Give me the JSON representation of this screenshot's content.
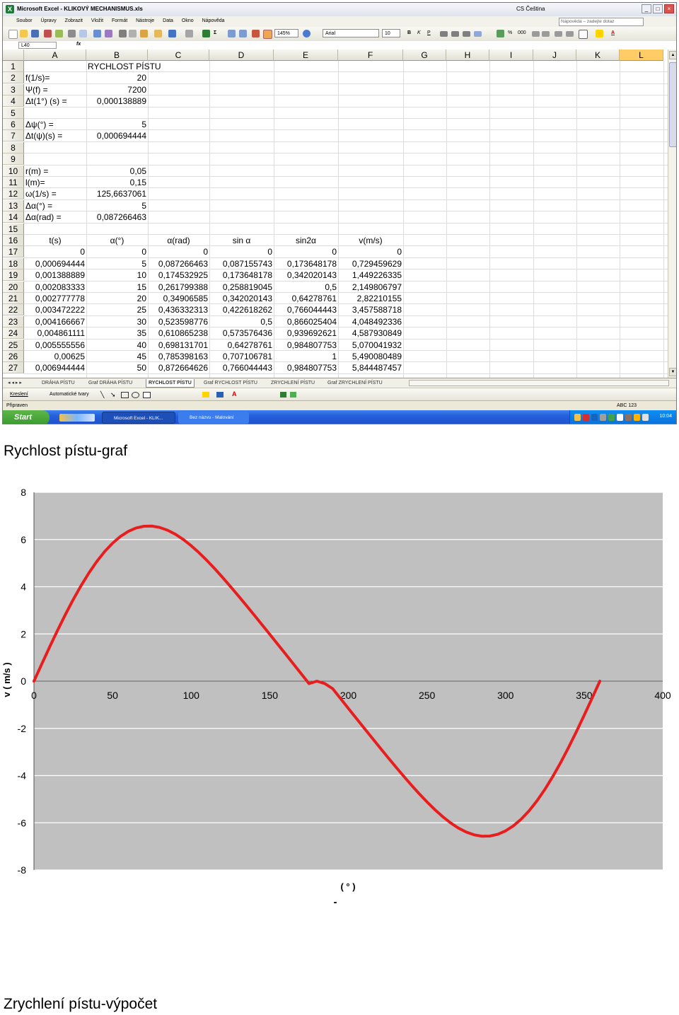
{
  "window": {
    "title": "Microsoft Excel - KLIKOVÝ MECHANISMUS.xls",
    "language": "CS Čeština",
    "buttons": [
      "_",
      "□",
      "×"
    ]
  },
  "menu": {
    "items": [
      "Soubor",
      "Úpravy",
      "Zobrazit",
      "Vložit",
      "Formát",
      "Nástroje",
      "Data",
      "Okno",
      "Nápověda"
    ],
    "help_placeholder": "Nápověda – zadejte dotaz"
  },
  "toolbar": {
    "zoom": "145%",
    "font": "Arial",
    "font_size": "10",
    "bold": "B",
    "italic": "K",
    "underline": "P"
  },
  "formula_bar": {
    "name_box": "L40",
    "fx": "fx",
    "content": ""
  },
  "sheet": {
    "columns": [
      "A",
      "B",
      "C",
      "D",
      "E",
      "F",
      "G",
      "H",
      "I",
      "J",
      "K",
      "L"
    ],
    "selected_column": "L",
    "rows": [
      {
        "n": "1",
        "A": "",
        "B": "RYCHLOST PÍSTU",
        "C": "",
        "D": "",
        "E": "",
        "F": ""
      },
      {
        "n": "2",
        "A": "f(1/s)=",
        "B": "20",
        "C": "",
        "D": "",
        "E": "",
        "F": ""
      },
      {
        "n": "3",
        "A": "Ψ(f) =",
        "B": "7200",
        "C": "",
        "D": "",
        "E": "",
        "F": ""
      },
      {
        "n": "4",
        "A": "Δt(1°) (s) =",
        "B": "0,000138889",
        "C": "",
        "D": "",
        "E": "",
        "F": ""
      },
      {
        "n": "5",
        "A": "",
        "B": "",
        "C": "",
        "D": "",
        "E": "",
        "F": ""
      },
      {
        "n": "6",
        "A": "Δψ(°) =",
        "B": "5",
        "C": "",
        "D": "",
        "E": "",
        "F": ""
      },
      {
        "n": "7",
        "A": "Δt(ψ)(s) =",
        "B": "0,000694444",
        "C": "",
        "D": "",
        "E": "",
        "F": ""
      },
      {
        "n": "8",
        "A": "",
        "B": "",
        "C": "",
        "D": "",
        "E": "",
        "F": ""
      },
      {
        "n": "9",
        "A": "",
        "B": "",
        "C": "",
        "D": "",
        "E": "",
        "F": ""
      },
      {
        "n": "10",
        "A": "r(m) =",
        "B": "0,05",
        "C": "",
        "D": "",
        "E": "",
        "F": ""
      },
      {
        "n": "11",
        "A": "l(m)=",
        "B": "0,15",
        "C": "",
        "D": "",
        "E": "",
        "F": ""
      },
      {
        "n": "12",
        "A": "ω(1/s) =",
        "B": "125,6637061",
        "C": "",
        "D": "",
        "E": "",
        "F": ""
      },
      {
        "n": "13",
        "A": "Δα(°) =",
        "B": "5",
        "C": "",
        "D": "",
        "E": "",
        "F": ""
      },
      {
        "n": "14",
        "A": "Δα(rad) =",
        "B": "0,087266463",
        "C": "",
        "D": "",
        "E": "",
        "F": ""
      },
      {
        "n": "15",
        "A": "",
        "B": "",
        "C": "",
        "D": "",
        "E": "",
        "F": ""
      },
      {
        "n": "16",
        "A": "t(s)",
        "B": "α(°)",
        "C": "α(rad)",
        "D": "sin α",
        "E": "sin2α",
        "F": "v(m/s)"
      },
      {
        "n": "17",
        "A": "0",
        "B": "0",
        "C": "0",
        "D": "0",
        "E": "0",
        "F": "0"
      },
      {
        "n": "18",
        "A": "0,000694444",
        "B": "5",
        "C": "0,087266463",
        "D": "0,087155743",
        "E": "0,173648178",
        "F": "0,729459629"
      },
      {
        "n": "19",
        "A": "0,001388889",
        "B": "10",
        "C": "0,174532925",
        "D": "0,173648178",
        "E": "0,342020143",
        "F": "1,449226335"
      },
      {
        "n": "20",
        "A": "0,002083333",
        "B": "15",
        "C": "0,261799388",
        "D": "0,258819045",
        "E": "0,5",
        "F": "2,149806797"
      },
      {
        "n": "21",
        "A": "0,002777778",
        "B": "20",
        "C": "0,34906585",
        "D": "0,342020143",
        "E": "0,64278761",
        "F": "2,82210155"
      },
      {
        "n": "22",
        "A": "0,003472222",
        "B": "25",
        "C": "0,436332313",
        "D": "0,422618262",
        "E": "0,766044443",
        "F": "3,457588718"
      },
      {
        "n": "23",
        "A": "0,004166667",
        "B": "30",
        "C": "0,523598776",
        "D": "0,5",
        "E": "0,866025404",
        "F": "4,048492336"
      },
      {
        "n": "24",
        "A": "0,004861111",
        "B": "35",
        "C": "0,610865238",
        "D": "0,573576436",
        "E": "0,939692621",
        "F": "4,587930849"
      },
      {
        "n": "25",
        "A": "0,005555556",
        "B": "40",
        "C": "0,698131701",
        "D": "0,64278761",
        "E": "0,984807753",
        "F": "5,070041932"
      },
      {
        "n": "26",
        "A": "0,00625",
        "B": "45",
        "C": "0,785398163",
        "D": "0,707106781",
        "E": "1",
        "F": "5,490080489"
      },
      {
        "n": "27",
        "A": "0,006944444",
        "B": "50",
        "C": "0,872664626",
        "D": "0,766044443",
        "E": "0,984807753",
        "F": "5,844487457"
      }
    ]
  },
  "tabs": {
    "items": [
      "DRÁHA PÍSTU",
      "Graf DRÁHA PÍSTU",
      "RYCHLOST PÍSTU",
      "Graf RYCHLOST PÍSTU",
      "ZRYCHLENÍ PÍSTU",
      "Graf ZRYCHLENÍ PÍSTU"
    ],
    "active": "RYCHLOST PÍSTU"
  },
  "drawing_toolbar": {
    "draw": "Kreslení",
    "autoshapes": "Automatické tvary"
  },
  "statusbar": {
    "left": "Připraven",
    "right": "ABC 123"
  },
  "taskbar": {
    "start": "Start",
    "tasks": [
      "Microsoft Excel - KLIK...",
      "Bez názvu - Malování"
    ],
    "clock": "10:04"
  },
  "headings": {
    "speed_graph": "Rychlost pístu-graf",
    "acceleration_calc": "Zrychlení pístu-výpočet"
  },
  "chart_data": {
    "type": "line",
    "title": "",
    "xlabel": "( ° )",
    "xlabel_extra": "-",
    "ylabel": "v ( m/s )",
    "xlim": [
      0,
      400
    ],
    "ylim": [
      -8,
      8
    ],
    "xticks": [
      0,
      50,
      100,
      150,
      200,
      250,
      300,
      350,
      400
    ],
    "yticks": [
      -8,
      -6,
      -4,
      -2,
      0,
      2,
      4,
      6,
      8
    ],
    "grid": true,
    "legend": "none",
    "series": [
      {
        "color": "#e81e1e",
        "x": [
          0,
          5,
          10,
          15,
          20,
          25,
          30,
          35,
          40,
          45,
          50,
          55,
          60,
          65,
          70,
          75,
          80,
          85,
          90,
          95,
          100,
          105,
          110,
          115,
          120,
          125,
          130,
          135,
          140,
          145,
          150,
          155,
          160,
          165,
          170,
          175,
          180,
          185,
          190,
          195,
          200,
          205,
          210,
          215,
          220,
          225,
          230,
          235,
          240,
          245,
          250,
          255,
          260,
          265,
          270,
          275,
          280,
          285,
          290,
          295,
          300,
          305,
          310,
          315,
          320,
          325,
          330,
          335,
          340,
          345,
          350,
          355,
          360
        ],
        "y": [
          0,
          0.729,
          1.449,
          2.15,
          2.822,
          3.458,
          4.048,
          4.588,
          5.07,
          5.49,
          5.844,
          6.129,
          6.344,
          6.488,
          6.562,
          6.569,
          6.511,
          6.393,
          6.222,
          6.001,
          5.739,
          5.441,
          5.114,
          4.764,
          4.394,
          4.011,
          3.617,
          3.216,
          2.809,
          2.398,
          1.985,
          1.569,
          1.152,
          0.734,
          0.315,
          -0.104,
          0,
          -0.104,
          -0.315,
          -0.734,
          -1.152,
          -1.569,
          -1.985,
          -2.398,
          -2.809,
          -3.216,
          -3.617,
          -4.011,
          -4.394,
          -4.764,
          -5.114,
          -5.441,
          -5.739,
          -6.001,
          -6.222,
          -6.393,
          -6.511,
          -6.569,
          -6.562,
          -6.488,
          -6.344,
          -6.129,
          -5.844,
          -5.49,
          -5.07,
          -4.588,
          -4.048,
          -3.458,
          -2.822,
          -2.15,
          -1.449,
          -0.729,
          0
        ]
      }
    ]
  },
  "colors": {
    "plot_background": "#c0c0c0",
    "series_line": "#e81e1e",
    "selected_column": "#ffcc66",
    "taskbar": "#245edb",
    "start_button": "#3a9a2e"
  }
}
